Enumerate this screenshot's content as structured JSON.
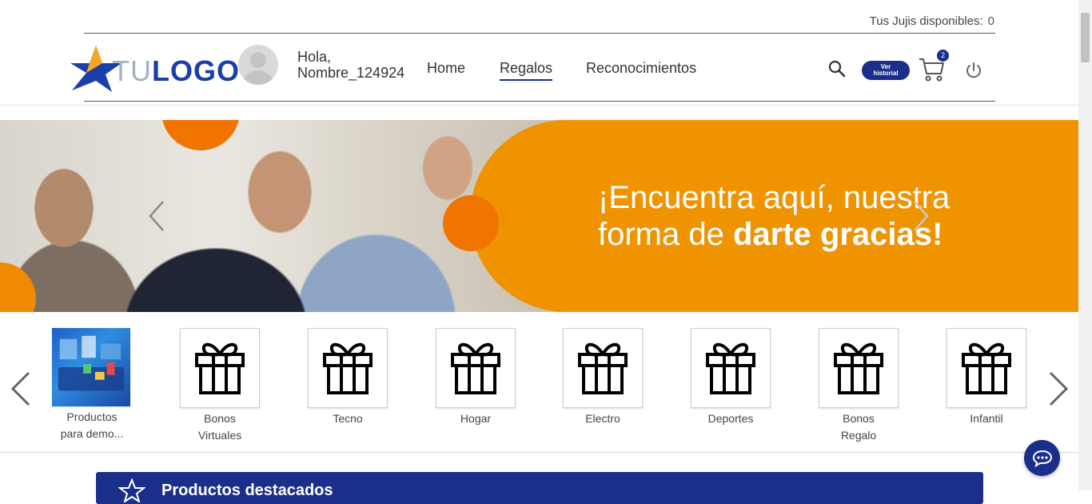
{
  "header": {
    "jujis_label": "Tus Jujis disponibles:",
    "jujis_value": "0",
    "logo_tu": "TU",
    "logo_logo": "LOGO",
    "greeting_line1": "Hola,",
    "greeting_line2": "Nombre_124924",
    "nav": {
      "home": "Home",
      "regalos": "Regalos",
      "reconocimientos": "Reconocimientos"
    },
    "ver_historial_line1": "Ver",
    "ver_historial_line2": "historial",
    "cart_count": "2",
    "accent_color": "#1b2f8a"
  },
  "banner": {
    "line1": "¡Encuentra aquí, nuestra",
    "line2_normal": "forma de ",
    "line2_bold": "darte gracias!",
    "orange": "#ef9400"
  },
  "categories": [
    {
      "line1": "Productos",
      "line2": "para demo...",
      "icon": "product-image"
    },
    {
      "line1": "Bonos",
      "line2": "Virtuales",
      "icon": "gift-icon"
    },
    {
      "line1": "Tecno",
      "line2": "",
      "icon": "gift-icon"
    },
    {
      "line1": "Hogar",
      "line2": "",
      "icon": "gift-icon"
    },
    {
      "line1": "Electro",
      "line2": "",
      "icon": "gift-icon"
    },
    {
      "line1": "Deportes",
      "line2": "",
      "icon": "gift-icon"
    },
    {
      "line1": "Bonos",
      "line2": "Regalo",
      "icon": "gift-icon"
    },
    {
      "line1": "Infantil",
      "line2": "",
      "icon": "gift-icon"
    }
  ],
  "featured": {
    "title": "Productos destacados"
  }
}
